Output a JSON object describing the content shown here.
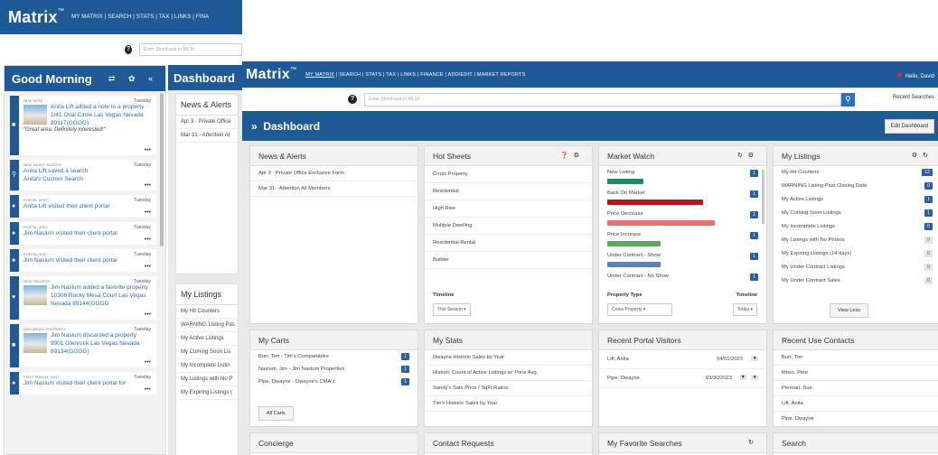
{
  "back": {
    "logo": "Matrix",
    "tm": "™",
    "nav": "MY MATRIX | SEARCH | STATS | TAX | LINKS | FINA",
    "search_placeholder": "Enter Shorthand or MLS#",
    "sidebar_title": "Good Morning",
    "sidebar_icons": "⇄ ✿ «",
    "dashboard_title": "Dashboard",
    "news_title": "News & Alerts",
    "news": [
      "Apr 3 - Private Office",
      "Mar 31 - Attention Al"
    ],
    "listings_title": "My Listings",
    "listings": [
      "My Hit Counters",
      "WARNING Listing Pas",
      "My Active Listings",
      "My Coming Soon Lis",
      "My Incomplete Listin",
      "My Listings with No P",
      "My Expiring Listings ("
    ],
    "activities": [
      {
        "kind": "New Note",
        "day": "Tuesday",
        "text": "Anita Lift added a note to a property",
        "sub": "1/41 Oval Circle Las Vegas Nevada 89117(GGGG)",
        "quote": "\"Great area. Definitely interested!\""
      },
      {
        "kind": "New Saved Search",
        "day": "Tuesday",
        "text": "Anita Lift saved a search",
        "sub": "Anita's Custom Search"
      },
      {
        "kind": "Portal Visit",
        "day": "Tuesday",
        "text": "Anita Lift visited their client portal"
      },
      {
        "kind": "Portal Visit",
        "day": "Tuesday",
        "text": "Jim Naslum visited their client portal"
      },
      {
        "kind": "Portal Visit",
        "day": "Tuesday",
        "text": "Jim Naslum visited their client portal"
      },
      {
        "kind": "New Favorite",
        "day": "Tuesday",
        "text": "Jim Naslum added a favorite property",
        "sub": "10308 Rocky Mesa Court Las Vegas Nevada 89144(GGGG"
      },
      {
        "kind": "Discarded Property",
        "day": "Tuesday",
        "text": "Jim Naslum discarded a property",
        "sub": "9901 Glenrock Las Vegas Nevada 89134(GGGG)"
      },
      {
        "kind": "First Portal Visit",
        "day": "Tuesday",
        "text": "Jim Naslum visited their client portal for"
      }
    ]
  },
  "front": {
    "logo": "Matrix",
    "tm": "™",
    "nav_first": "MY MATRIX",
    "nav_rest": "| SEARCH | STATS | TAX | LINKS | FINANCE | ADD/EDIT | MARKET REPORTS",
    "greeting": "Hello, David",
    "search_placeholder": "Enter Shorthand or MLS#",
    "recent_searches": "Recent Searches",
    "dashboard_title": "Dashboard",
    "edit_button": "Edit Dashboard",
    "news": {
      "title": "News & Alerts",
      "items": [
        "Apr 3 - Private Office Exclusive Form",
        "Mar 31 - Attention All Members"
      ]
    },
    "hotsheets": {
      "title": "Hot Sheets",
      "items": [
        "Cross Property",
        "Residential",
        "High Rise",
        "Multiple Dwelling",
        "Residential Rental",
        "Builder"
      ],
      "timeline_label": "Timeline",
      "timeline_value": "This Season"
    },
    "market": {
      "title": "Market Watch",
      "items": [
        {
          "label": "New Listing",
          "value": 1,
          "color": "#1f8a6a",
          "fill": 0.3
        },
        {
          "label": "Back On Market",
          "value": 1,
          "color": "#a81c1c",
          "fill": 0.8
        },
        {
          "label": "Price Decrease",
          "value": 1,
          "color": "#ec6f6f",
          "fill": 0.9
        },
        {
          "label": "Price Increase",
          "value": 1,
          "color": "#5aa85a",
          "fill": 0.45
        },
        {
          "label": "Under Contract - Show",
          "value": 1,
          "color": "#5c82b8",
          "fill": 0.45
        },
        {
          "label": "Under Contract - No Show",
          "value": 1,
          "color": "#e8c23a",
          "fill": 0.05
        }
      ],
      "ptype_label": "Property Type",
      "ptype_value": "Cross Property",
      "timeline_label": "Timeline",
      "timeline_value": "Today"
    },
    "mylistings": {
      "title": "My Listings",
      "items": [
        {
          "label": "My Hit Counters",
          "badge": "12",
          "dark": true
        },
        {
          "label": "WARNING Listing Past Closing Date",
          "badge": "0",
          "dark": true
        },
        {
          "label": "My Active Listings",
          "badge": "1",
          "dark": true
        },
        {
          "label": "My Coming Soon Listings",
          "badge": "1",
          "dark": true
        },
        {
          "label": "My Incomplete Listings",
          "badge": "0",
          "dark": true
        },
        {
          "label": "My Listings with No Photos",
          "badge": "0",
          "dark": false
        },
        {
          "label": "My Expiring Listings (14 days)",
          "badge": "0",
          "dark": false
        },
        {
          "label": "My Under Contract Listings",
          "badge": "0",
          "dark": false
        },
        {
          "label": "My Under Contract Sales",
          "badge": "0",
          "dark": false
        }
      ],
      "view_less": "View Less"
    },
    "carts": {
      "title": "My Carts",
      "items": [
        {
          "label": "Burr, Tim - Tim's Comparables",
          "badge": "1"
        },
        {
          "label": "Naslum, Jim - Jim Naslum Properties",
          "badge": "1"
        },
        {
          "label": "Pipe, Dwayne - Dwayne's CMA's",
          "badge": "1"
        }
      ],
      "all_carts": "All Carts"
    },
    "stats": {
      "title": "My Stats",
      "items": [
        "Dwayne Historic Sales by Year",
        "Historic Count of Active Listings w/ Price Avg.",
        "Sandy's Sale Price / SqFt Ratios",
        "Tim's Historic Sales by Year"
      ]
    },
    "visitors": {
      "title": "Recent Portal Visitors",
      "items": [
        {
          "name": "Lift, Anita",
          "date": "04/01/2023"
        },
        {
          "name": "Pipe, Dwayne",
          "date": "03/30/2023"
        }
      ]
    },
    "contacts": {
      "title": "Recent Use Contacts",
      "items": [
        "Burr, Tim",
        "Moss, Pete",
        "Perman, Sue",
        "Lift, Anita",
        "Pipe, Dwayne"
      ]
    },
    "bottom": {
      "concierge": "Concierge",
      "contact_requests": "Contact Requests",
      "favorite_searches": "My Favorite Searches",
      "search": "Search"
    }
  }
}
